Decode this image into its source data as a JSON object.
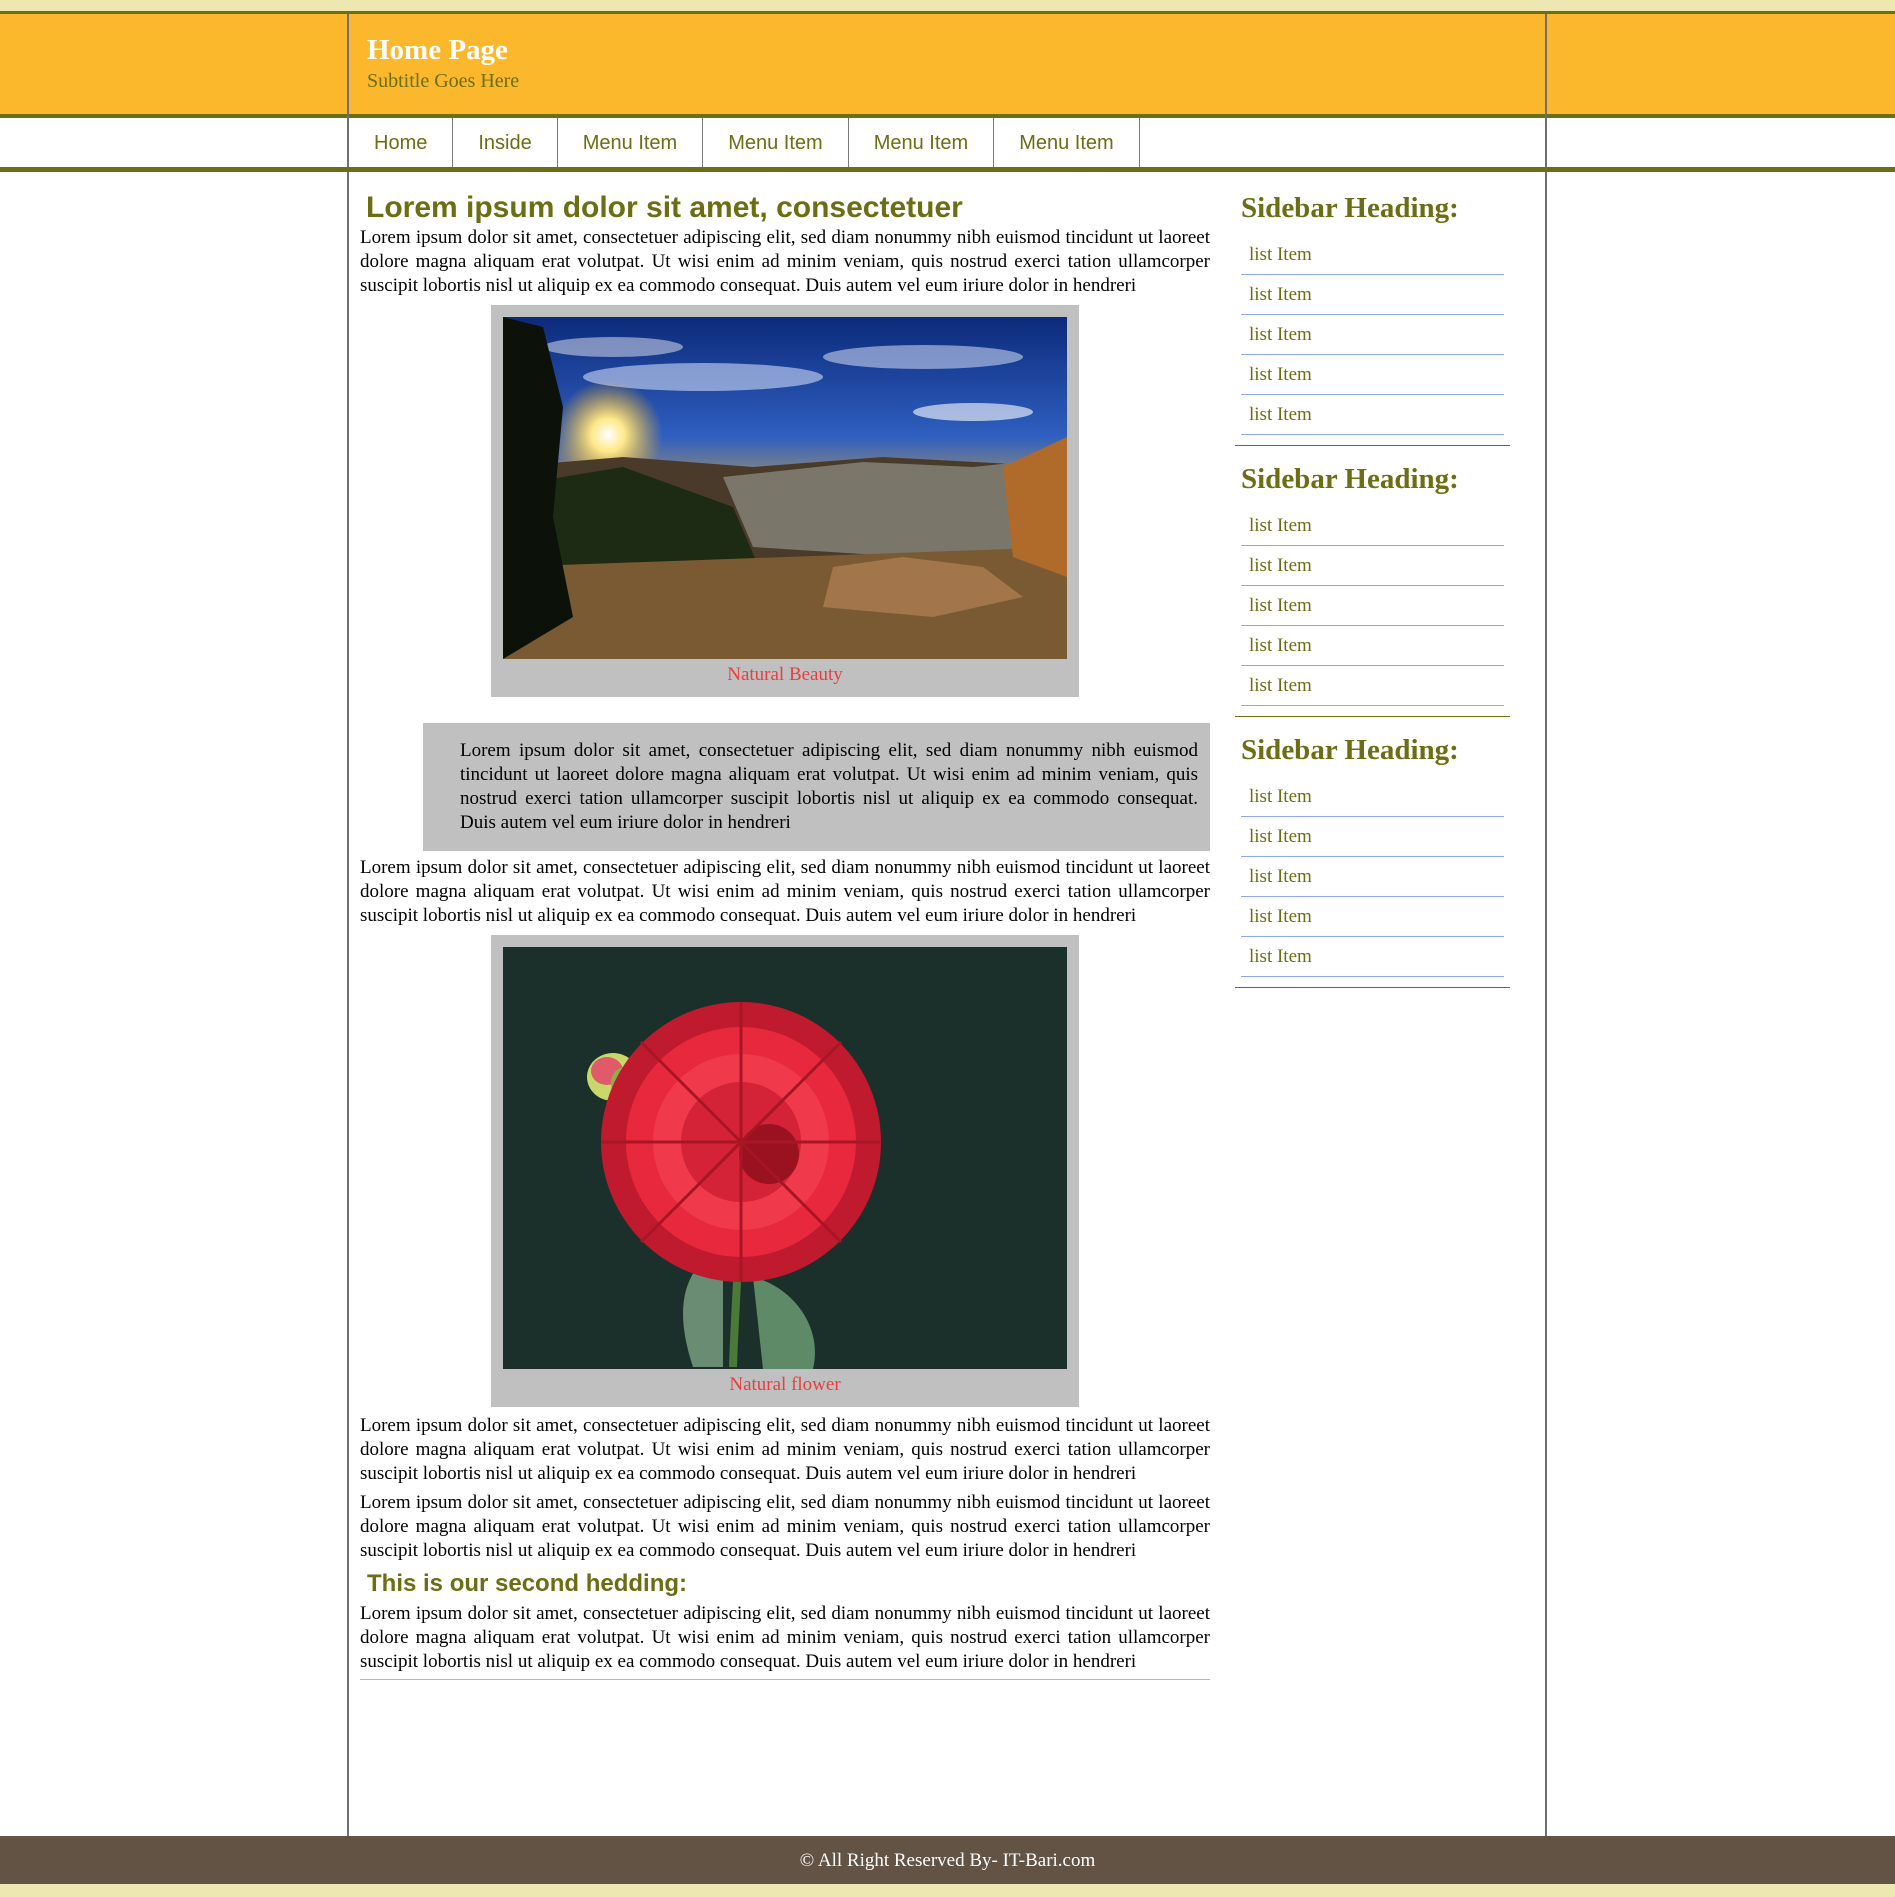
{
  "header": {
    "title": "Home Page",
    "subtitle": "Subtitle Goes Here"
  },
  "nav": {
    "items": [
      "Home",
      "Inside",
      "Menu Item",
      "Menu Item",
      "Menu Item",
      "Menu Item"
    ]
  },
  "main": {
    "heading": "Lorem ipsum dolor sit amet, consectetuer",
    "paragraph": "Lorem ipsum dolor sit amet, consectetuer adipiscing elit, sed diam nonummy nibh euismod tincidunt ut laoreet dolore magna aliquam erat volutpat. Ut wisi enim ad minim veniam, quis nostrud exerci tation ullamcorper suscipit lobortis nisl ut aliquip ex ea commodo consequat. Duis autem vel eum iriure dolor in hendreri",
    "figure1_caption": "Natural Beauty",
    "blockquote": "Lorem ipsum dolor sit amet, consectetuer adipiscing elit, sed diam nonummy nibh euismod tincidunt ut laoreet dolore magna aliquam erat volutpat. Ut wisi enim ad minim veniam, quis nostrud exerci tation ullamcorper suscipit lobortis nisl ut aliquip ex ea commodo consequat. Duis autem vel eum iriure dolor in hendreri",
    "figure2_caption": "Natural flower",
    "second_heading": "This is our second hedding:"
  },
  "sidebar": {
    "heading": "Sidebar Heading:",
    "item": "list Item"
  },
  "footer": {
    "text": "© All Right Reserved By- IT-Bari.com"
  },
  "colors": {
    "header_bg": "#fbb82c",
    "accent_olive": "#6b6e12",
    "caption_red": "#e83e3e",
    "footer_bg": "#625345",
    "panel_gray": "#c0c0c0",
    "strip_cream": "#ede7b1"
  }
}
